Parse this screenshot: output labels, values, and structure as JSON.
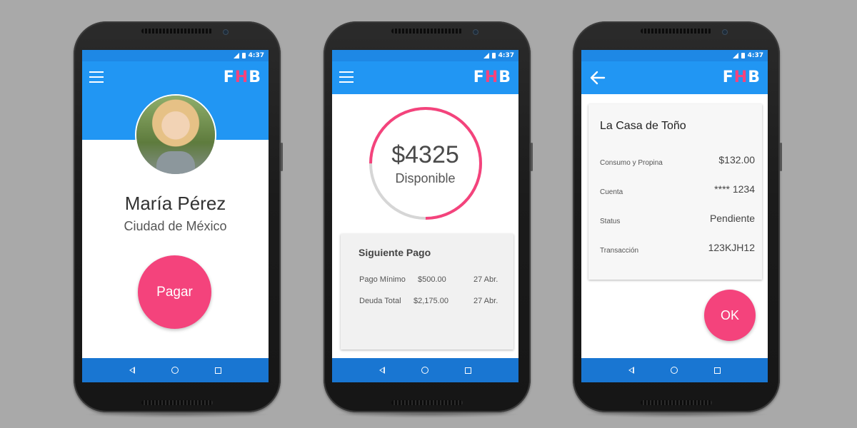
{
  "status": {
    "time": "4:37"
  },
  "brand": {
    "logo_left": "F",
    "logo_mid": "H",
    "logo_right": "B",
    "accent": "#f4437c",
    "primary": "#2196f3",
    "navbar": "#1976d2"
  },
  "icons": {
    "menu": "hamburger-icon",
    "back": "arrow-left-icon",
    "nav_back": "triangle-back-icon",
    "nav_home": "circle-home-icon",
    "nav_recents": "square-recents-icon"
  },
  "screen1": {
    "name": "María Pérez",
    "city": "Ciudad de México",
    "pay_button": "Pagar"
  },
  "screen2": {
    "amount": "$4325",
    "amount_label": "Disponible",
    "available_fraction": 0.75,
    "card_title": "Siguiente Pago",
    "rows": [
      {
        "label": "Pago Mínimo",
        "amount": "$500.00",
        "date": "27 Abr."
      },
      {
        "label": "Deuda Total",
        "amount": "$2,175.00",
        "date": "27 Abr."
      }
    ]
  },
  "screen3": {
    "merchant": "La Casa de Toño",
    "details": [
      {
        "label": "Consumo y Propina",
        "value": "$132.00"
      },
      {
        "label": "Cuenta",
        "value": "**** 1234"
      },
      {
        "label": "Status",
        "value": "Pendiente"
      },
      {
        "label": "Transacción",
        "value": "123KJH12"
      }
    ],
    "ok_button": "OK"
  }
}
